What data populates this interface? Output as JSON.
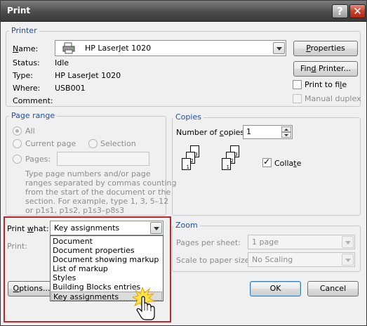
{
  "window": {
    "title": "Print",
    "help_glyph": "?",
    "close_glyph": "✕"
  },
  "printer": {
    "group_label": "Printer",
    "name_label": "Name:",
    "name_value": "HP LaserJet 1020",
    "status_label": "Status:",
    "status_value": "Idle",
    "type_label": "Type:",
    "type_value": "HP LaserJet 1020",
    "where_label": "Where:",
    "where_value": "USB001",
    "comment_label": "Comment:",
    "comment_value": "",
    "properties_button": "Properties",
    "find_printer_button": "Find Printer...",
    "print_to_file_label": "Print to file",
    "print_to_file_checked": false,
    "manual_duplex_label": "Manual duplex",
    "manual_duplex_checked": false
  },
  "page_range": {
    "group_label": "Page range",
    "all_label": "All",
    "current_page_label": "Current page",
    "selection_label": "Selection",
    "pages_label": "Pages:",
    "pages_value": "",
    "selected_option": "all",
    "help_lines": [
      "Type page numbers and/or page",
      "ranges separated by commas counting",
      "from the start of the document or the",
      "section. For example, type 1, 3, 5–12",
      "or p1s1, p1s2, p1s3–p8s3"
    ]
  },
  "copies": {
    "group_label": "Copies",
    "number_label": "Number of copies:",
    "number_value": "1",
    "collate_label": "Collate",
    "collate_checked": true,
    "page_numbers": [
      "3",
      "2",
      "1"
    ]
  },
  "print_what": {
    "label": "Print what:",
    "value": "Key assignments",
    "print_label": "Print:",
    "options": [
      "Document",
      "Document properties",
      "Document showing markup",
      "List of markup",
      "Styles",
      "Building Blocks entries",
      "Key assignments"
    ],
    "selected_index": 6
  },
  "zoom": {
    "group_label": "Zoom",
    "pages_per_sheet_label": "Pages per sheet:",
    "pages_per_sheet_value": "1 page",
    "scale_label": "Scale to paper size:",
    "scale_value": "No Scaling"
  },
  "footer": {
    "options_button": "Options...",
    "ok_button": "OK",
    "cancel_button": "Cancel"
  },
  "colors": {
    "group_label": "#1f4ea3",
    "highlight_box": "#c0272d"
  }
}
